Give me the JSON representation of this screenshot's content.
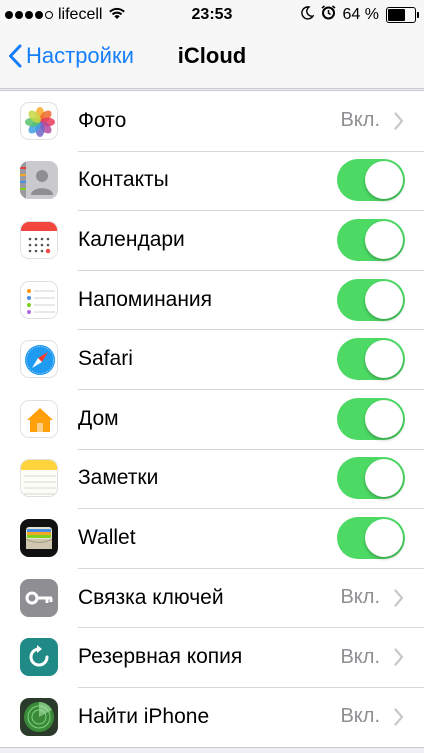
{
  "status_bar": {
    "carrier": "lifecell",
    "time": "23:53",
    "battery": "64 %",
    "battery_level": 0.64,
    "signal_bars": 4
  },
  "nav": {
    "back_label": "Настройки",
    "title": "iCloud"
  },
  "colors": {
    "accent": "#157efb",
    "toggle_on": "#4cd964",
    "secondary_text": "#8e8e93"
  },
  "rows": [
    {
      "label": "Фото",
      "icon": "photos-icon",
      "value": "Вкл.",
      "type": "detail"
    },
    {
      "label": "Контакты",
      "icon": "contacts-icon",
      "type": "toggle",
      "on": true
    },
    {
      "label": "Календари",
      "icon": "calendar-icon",
      "type": "toggle",
      "on": true
    },
    {
      "label": "Напоминания",
      "icon": "reminders-icon",
      "type": "toggle",
      "on": true
    },
    {
      "label": "Safari",
      "icon": "safari-icon",
      "type": "toggle",
      "on": true
    },
    {
      "label": "Дом",
      "icon": "home-icon",
      "type": "toggle",
      "on": true
    },
    {
      "label": "Заметки",
      "icon": "notes-icon",
      "type": "toggle",
      "on": true
    },
    {
      "label": "Wallet",
      "icon": "wallet-icon",
      "type": "toggle",
      "on": true
    },
    {
      "label": "Связка ключей",
      "icon": "keychain-icon",
      "value": "Вкл.",
      "type": "detail"
    },
    {
      "label": "Резервная копия",
      "icon": "backup-icon",
      "value": "Вкл.",
      "type": "detail"
    },
    {
      "label": "Найти iPhone",
      "icon": "find-iphone-icon",
      "value": "Вкл.",
      "type": "detail"
    }
  ]
}
